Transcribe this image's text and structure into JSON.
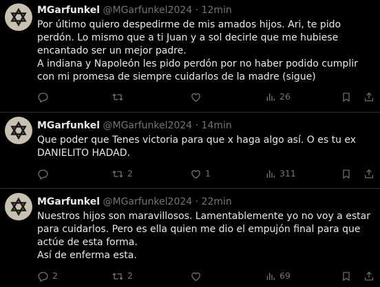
{
  "colors": {
    "background": "#000000",
    "text_primary": "#e7e9ea",
    "text_secondary": "#71767b",
    "divider": "#2f3336",
    "avatar_bg": "#c9c1b0",
    "avatar_icon": "#1a1a1a"
  },
  "tweets": [
    {
      "name": "MGarfunkel",
      "handle": "@MGarfunkel2024",
      "separator": "·",
      "time": "12min",
      "lines": [
        "Por último quiero despedirme de mis amados hijos. Ari, te pido perdón. Lo mismo que a ti Juan y a sol decirle que me hubiese encantado ser un mejor padre.",
        "A indiana y Napoleón les pido perdón por no haber podido cumplir con mi promesa de siempre cuidarlos de la madre (sigue)"
      ],
      "replies": "",
      "retweets": "",
      "likes": "",
      "views": "26",
      "icons": [
        "reply-icon",
        "retweet-icon",
        "like-icon",
        "views-icon",
        "bookmark-icon",
        "share-icon"
      ]
    },
    {
      "name": "MGarfunkel",
      "handle": "@MGarfunkel2024",
      "separator": "·",
      "time": "14min",
      "lines": [
        "Que poder que Tenes victoria para que x haga algo así. O es tu ex DANIELITO HADAD."
      ],
      "replies": "",
      "retweets": "2",
      "likes": "1",
      "views": "311",
      "icons": [
        "reply-icon",
        "retweet-icon",
        "like-icon",
        "views-icon",
        "bookmark-icon",
        "share-icon"
      ]
    },
    {
      "name": "MGarfunkel",
      "handle": "@MGarfunkel2024",
      "separator": "·",
      "time": "22min",
      "lines": [
        "Nuestros hijos son maravillosos. Lamentablemente yo no voy a estar para cuidarlos. Pero es ella quien me dio el empujón final para que actúe de esta forma.",
        "Así de enferma esta."
      ],
      "replies": "2",
      "retweets": "2",
      "likes": "",
      "views": "69",
      "icons": [
        "reply-icon",
        "retweet-icon",
        "like-icon",
        "views-icon",
        "bookmark-icon",
        "share-icon"
      ]
    }
  ]
}
